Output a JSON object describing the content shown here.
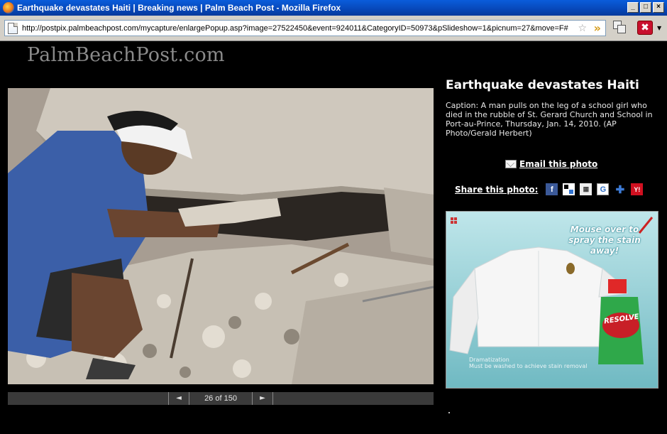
{
  "window": {
    "title": "Earthquake devastates Haiti | Breaking news | Palm Beach Post - Mozilla Firefox",
    "buttons": {
      "minimize": "_",
      "maximize": "□",
      "close": "×"
    }
  },
  "addressbar": {
    "url": "http://postpix.palmbeachpost.com/mycapture/enlargePopup.asp?image=27522450&event=924011&CategoryID=50973&pSlideshow=1&picnum=27&move=F#1"
  },
  "site": {
    "logo": "PalmBeachPost.com"
  },
  "gallery": {
    "headline": "Earthquake devastates Haiti",
    "caption": "Caption: A man pulls on the leg of a school girl who died in the rubble of St. Gerard Church and School in Port-au-Prince, Thursday, Jan. 14, 2010. (AP Photo/Gerald Herbert)",
    "email_label": "Email this photo",
    "share_label": "Share this photo:",
    "counter": "26 of 150",
    "prev_glyph": "◄",
    "next_glyph": "►",
    "share_icons": [
      {
        "name": "facebook-icon",
        "glyph": "f"
      },
      {
        "name": "delicious-icon",
        "glyph": ""
      },
      {
        "name": "digg-icon",
        "glyph": "▦"
      },
      {
        "name": "google-icon",
        "glyph": "G"
      },
      {
        "name": "diigo-icon",
        "glyph": "✚"
      },
      {
        "name": "yahoo-icon",
        "glyph": "Y!"
      }
    ]
  },
  "ad": {
    "headline": "Mouse over to spray the stain away!",
    "fine_print": "Dramatization\nMust be washed to achieve stain removal",
    "brand": "RESOLVE"
  },
  "colors": {
    "titlebar": "#0747b8",
    "background": "#000000",
    "facebook": "#3b5998"
  }
}
